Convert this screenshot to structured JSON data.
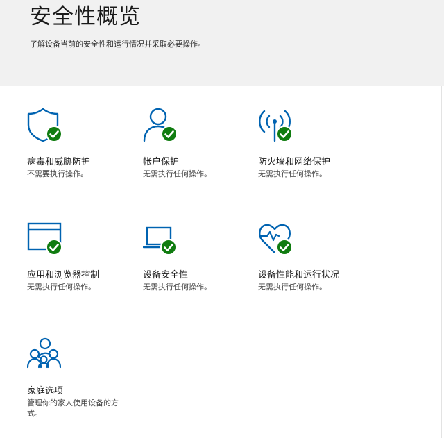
{
  "page": {
    "title": "安全性概览",
    "subtitle": "了解设备当前的安全性和运行情况并采取必要操作。"
  },
  "tiles": [
    {
      "id": "virus",
      "icon": "shield-check-icon",
      "title": "病毒和威胁防护",
      "status": "不需要执行操作。"
    },
    {
      "id": "account",
      "icon": "person-check-icon",
      "title": "帐户保护",
      "status": "无需执行任何操作。"
    },
    {
      "id": "firewall",
      "icon": "antenna-check-icon",
      "title": "防火墙和网络保护",
      "status": "无需执行任何操作。"
    },
    {
      "id": "appbrowser",
      "icon": "browser-window-check-icon",
      "title": "应用和浏览器控制",
      "status": "无需执行任何操作。"
    },
    {
      "id": "device",
      "icon": "laptop-check-icon",
      "title": "设备安全性",
      "status": "无需执行任何操作。"
    },
    {
      "id": "health",
      "icon": "heart-pulse-check-icon",
      "title": "设备性能和运行状况",
      "status": "无需执行任何操作。"
    },
    {
      "id": "family",
      "icon": "family-people-icon",
      "title": "家庭选项",
      "status": "管理你的家人使用设备的方式。"
    }
  ],
  "colors": {
    "icon_blue": "#0063b1",
    "check_green": "#107c10",
    "header_bg": "#f1f1f1"
  }
}
